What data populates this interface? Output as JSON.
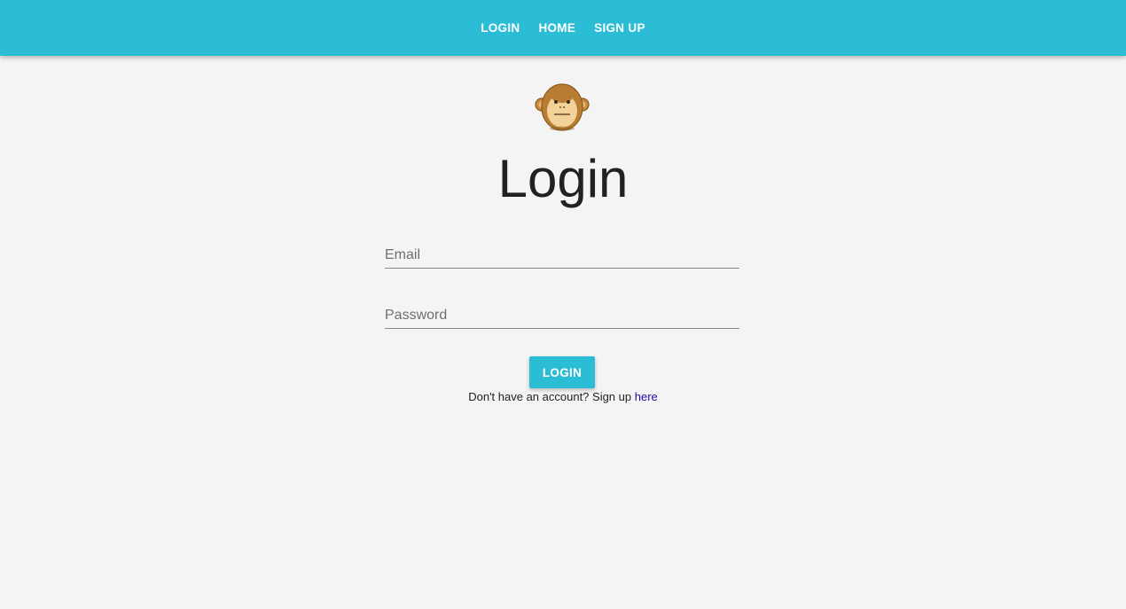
{
  "nav": {
    "items": [
      {
        "label": "LOGIN"
      },
      {
        "label": "HOME"
      },
      {
        "label": "SIGN UP"
      }
    ]
  },
  "logo": {
    "icon": "monkey-face-icon"
  },
  "page": {
    "title": "Login"
  },
  "form": {
    "email": {
      "placeholder": "Email",
      "value": ""
    },
    "password": {
      "placeholder": "Password",
      "value": ""
    },
    "submit_label": "LOGIN"
  },
  "signup": {
    "prompt": "Don't have an account? Sign up",
    "link_label": "here"
  },
  "colors": {
    "accent": "#2cbdd6",
    "background": "#f4f4f4",
    "link": "#1a0dab"
  }
}
